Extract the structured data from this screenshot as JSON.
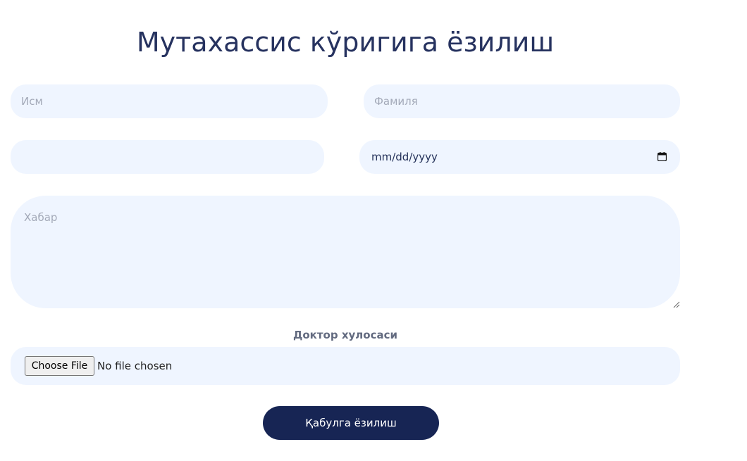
{
  "form": {
    "title": "Мутахассис кўригига ёзилиш",
    "first_name": {
      "placeholder": "Исм",
      "value": ""
    },
    "last_name": {
      "placeholder": "Фамиля",
      "value": ""
    },
    "phone": {
      "placeholder": "",
      "value": ""
    },
    "date": {
      "display": "mm/dd/yyyy",
      "icon": "calendar-icon"
    },
    "message": {
      "placeholder": "Хабар",
      "value": ""
    },
    "file_label": "Доктор хулосаси",
    "file": {
      "button_label": "Choose File",
      "status": "No file chosen"
    },
    "submit_label": "Қабулга ёзилиш"
  },
  "colors": {
    "title": "#26325f",
    "field_background": "#eff5ff",
    "placeholder": "#a3a9b8",
    "label": "#636b80",
    "button": "#172554",
    "button_text": "#ffffff"
  }
}
